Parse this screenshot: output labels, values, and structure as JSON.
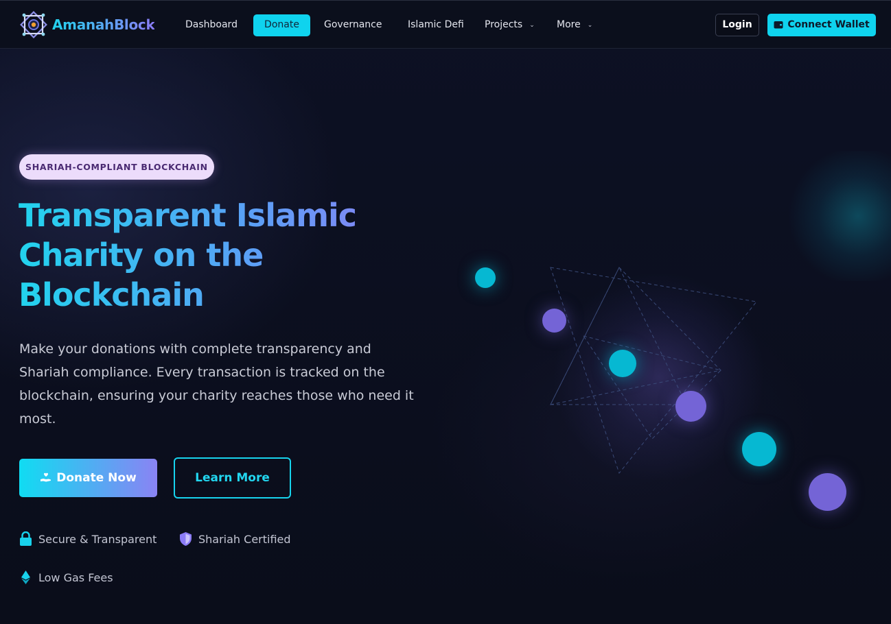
{
  "brand": {
    "name": "AmanahBlock"
  },
  "nav": {
    "items": [
      {
        "label": "Dashboard",
        "active": false
      },
      {
        "label": "Donate",
        "active": true
      },
      {
        "label": "Governance",
        "active": false
      },
      {
        "label": "Islamic Defi",
        "active": false
      },
      {
        "label": "Projects",
        "dropdown": true
      },
      {
        "label": "More",
        "dropdown": true
      }
    ],
    "login_label": "Login",
    "wallet_label": "Connect Wallet"
  },
  "hero": {
    "badge": "SHARIAH-COMPLIANT BLOCKCHAIN",
    "title_lines": [
      "Transparent Islamic",
      "Charity on the",
      "Blockchain"
    ],
    "description": "Make your donations with complete transparency and Shariah compliance. Every transaction is tracked on the blockchain, ensuring your charity reaches those who need it most.",
    "primary_cta": "Donate Now",
    "secondary_cta": "Learn More",
    "features": [
      {
        "label": "Secure & Transparent",
        "icon": "lock-icon"
      },
      {
        "label": "Shariah Certified",
        "icon": "shield-icon"
      },
      {
        "label": "Low Gas Fees",
        "icon": "ethereum-icon"
      }
    ]
  },
  "colors": {
    "accent_cyan": "#0fd3ee",
    "accent_violet": "#8a83f3",
    "background": "#0b0f1e",
    "badge_bg": "#ecdcfb"
  }
}
